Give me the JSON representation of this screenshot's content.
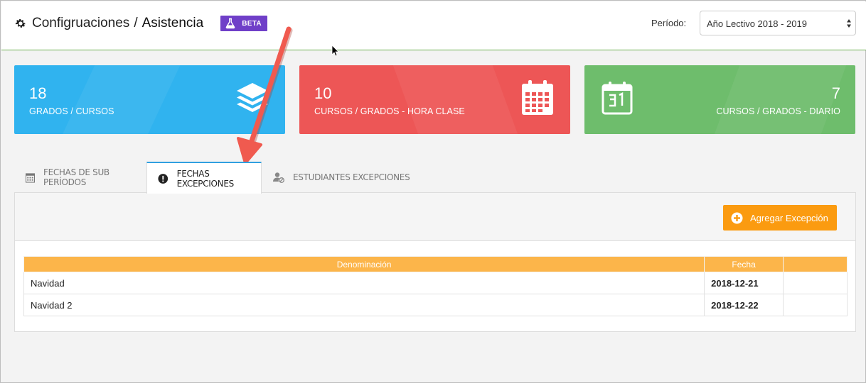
{
  "header": {
    "title_prefix": "Configruaciones",
    "title_separator": "/",
    "title_page": "Asistencia",
    "beta_badge": "BETA",
    "periodo_label": "Período:",
    "periodo_value": "Año Lectivo 2018 - 2019"
  },
  "cards": [
    {
      "value": "18",
      "label": "GRADOS / CURSOS",
      "icon": "layers-icon",
      "color": "#30b3ef"
    },
    {
      "value": "10",
      "label": "CURSOS / GRADOS - HORA CLASE",
      "icon": "calendar-grid-icon",
      "color": "#ed5656"
    },
    {
      "value": "7",
      "label": "CURSOS / GRADOS - DIARIO",
      "icon": "calendar-31-icon",
      "color": "#6ebd6c"
    }
  ],
  "tabs": [
    {
      "label": "FECHAS DE SUB PERÍODOS",
      "icon": "calendar-icon",
      "active": false
    },
    {
      "label": "FECHAS EXCEPCIONES",
      "icon": "exclamation-circle-icon",
      "active": true
    },
    {
      "label": "ESTUDIANTES EXCEPCIONES",
      "icon": "user-block-icon",
      "active": false
    }
  ],
  "panel": {
    "add_button": "Agregar Excepción",
    "table": {
      "columns": [
        "Denominación",
        "Fecha",
        ""
      ],
      "rows": [
        {
          "denominacion": "Navidad",
          "fecha": "2018-12-21"
        },
        {
          "denominacion": "Navidad 2",
          "fecha": "2018-12-22"
        }
      ]
    }
  },
  "colors": {
    "accent_blue": "#30b3ef",
    "accent_red": "#ed5656",
    "accent_green": "#6ebd6c",
    "beta_purple": "#6f3fc8",
    "button_orange": "#fb9b10",
    "table_header": "#fcb54a",
    "annotation_arrow": "#f05a4f"
  }
}
